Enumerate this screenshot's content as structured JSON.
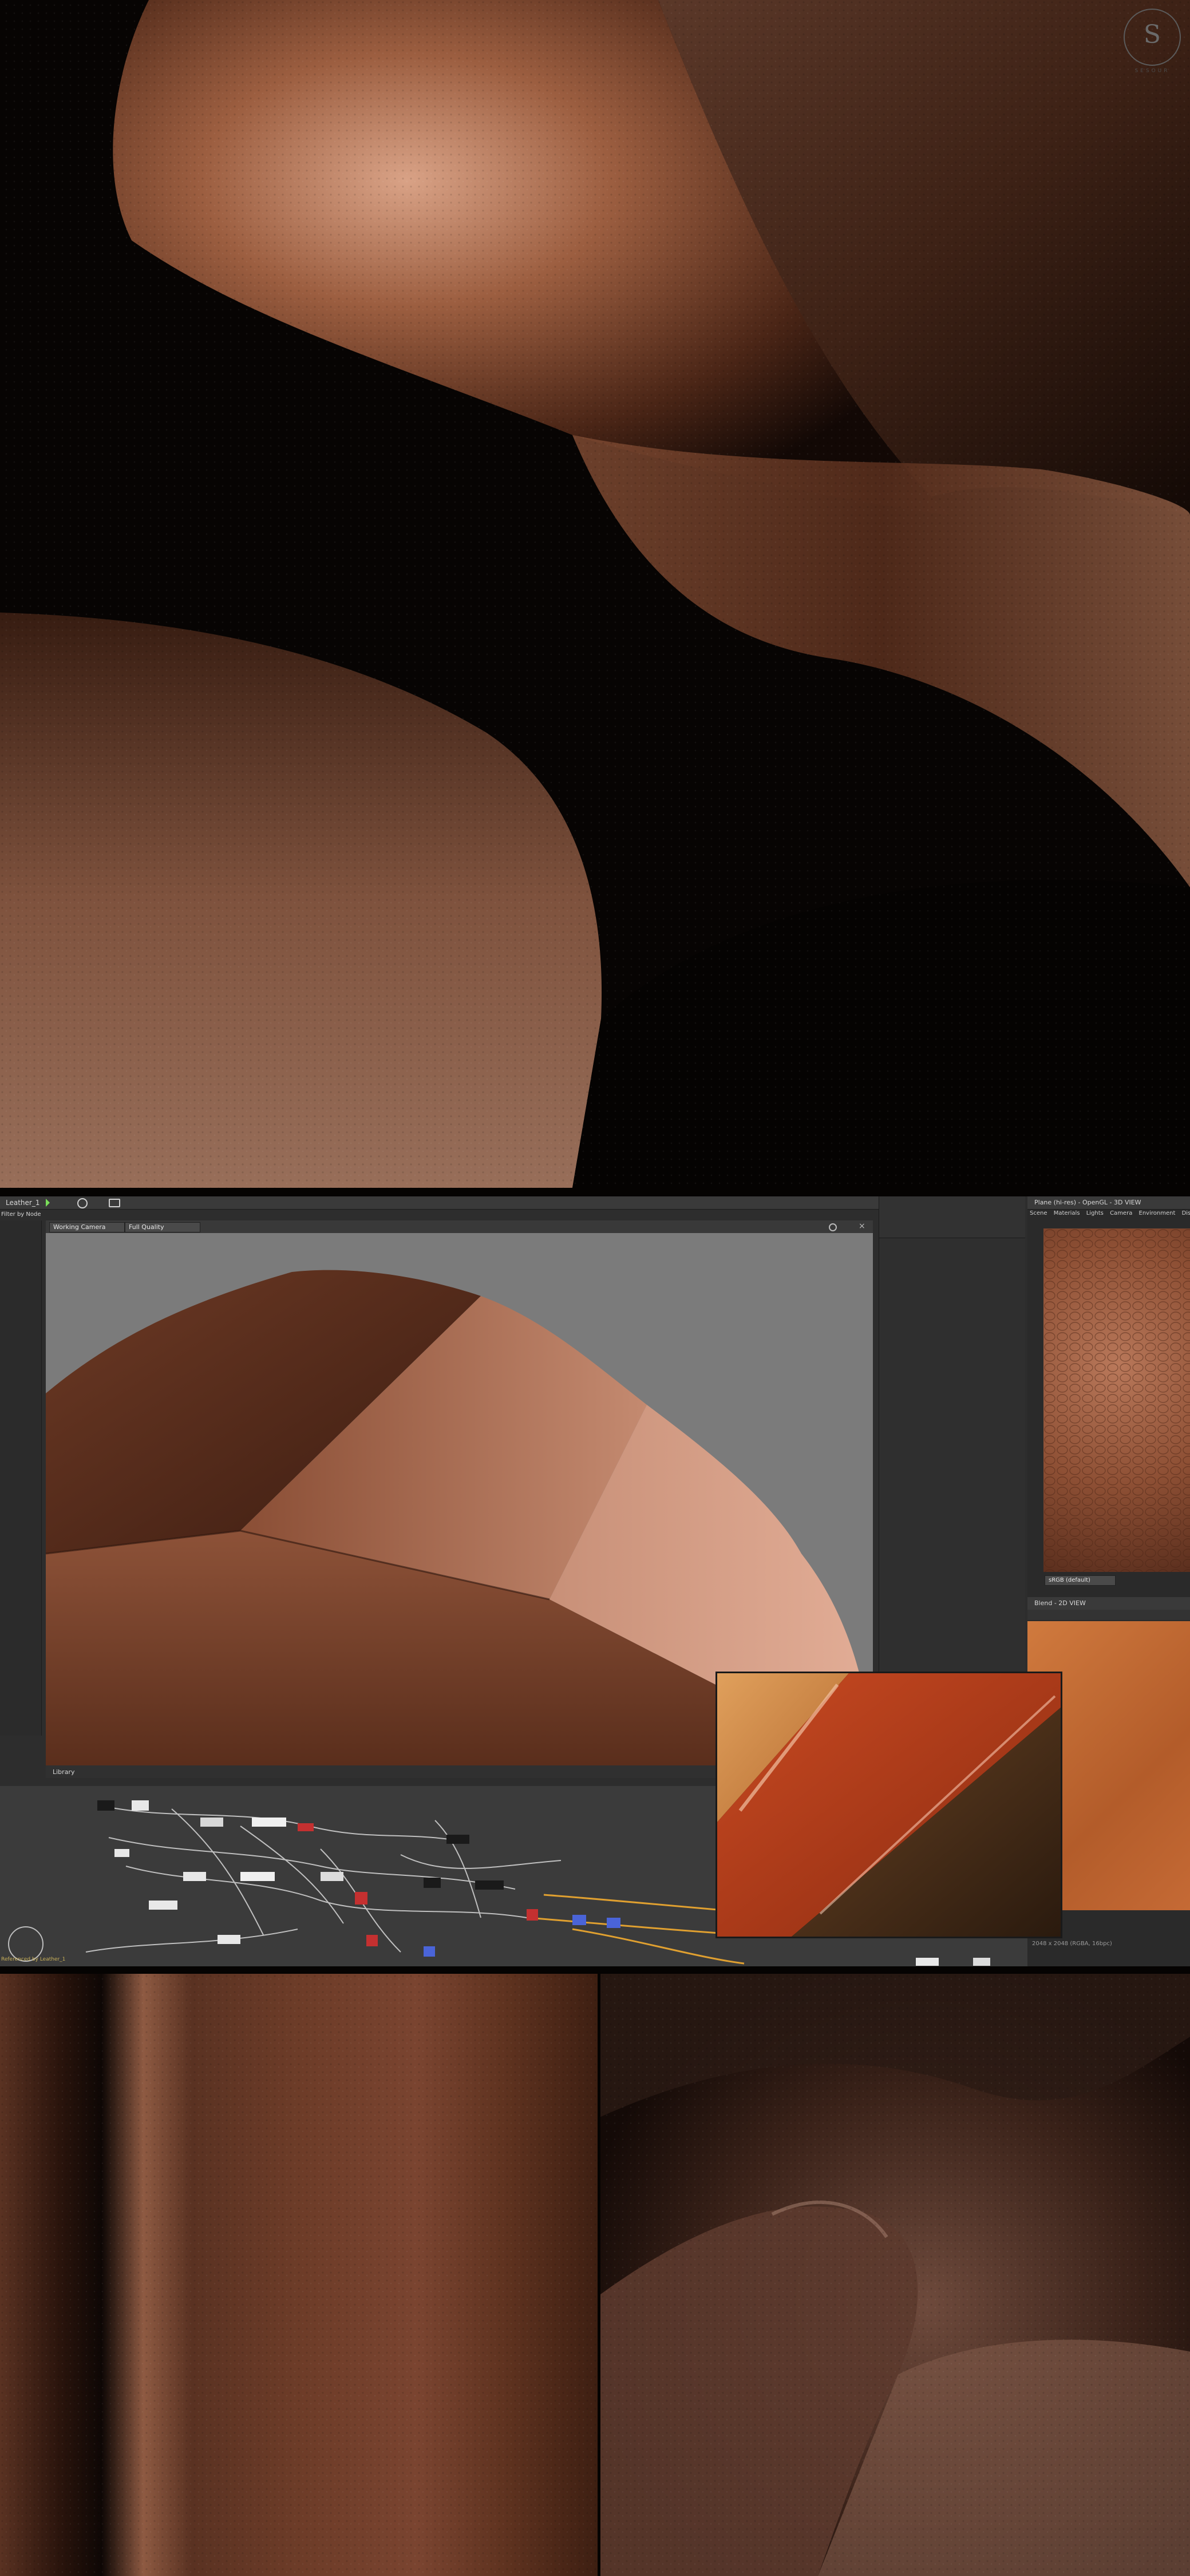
{
  "logo": {
    "letter": "S",
    "caption": "SESOUR"
  },
  "ui": {
    "graph_tab_title": "Leather_1",
    "filter_label": "Filter by Node",
    "camera_dropdown": "Working Camera",
    "quality_dropdown": "Full Quality",
    "library_tab": "Library",
    "view3d_title": "Plane (hi-res) - OpenGL - 3D VIEW",
    "view3d_menu": [
      "Scene",
      "Materials",
      "Lights",
      "Camera",
      "Environment",
      "Display"
    ],
    "view3d_status": "sRGB (default)",
    "view2d_title": "Blend - 2D VIEW",
    "view2d_status": "2048 x 2048 (RGBA, 16bpc)",
    "graph_footer_text": "Referenced by Leather_1"
  },
  "colors": {
    "leather_brown": "#8a5236",
    "leather_light": "#c9896a",
    "orange_leather": "#c56a35",
    "graph_bg": "#3b3b3b",
    "viewport_bg": "#7b7b7b",
    "wire_orange": "#e0a030",
    "node_red": "#c43030",
    "node_blue": "#4a64d8"
  },
  "icons": [
    "logo-seal-icon",
    "pointer-tool-icon",
    "globe-icon",
    "camera-icon",
    "settings-icon",
    "close-icon"
  ]
}
